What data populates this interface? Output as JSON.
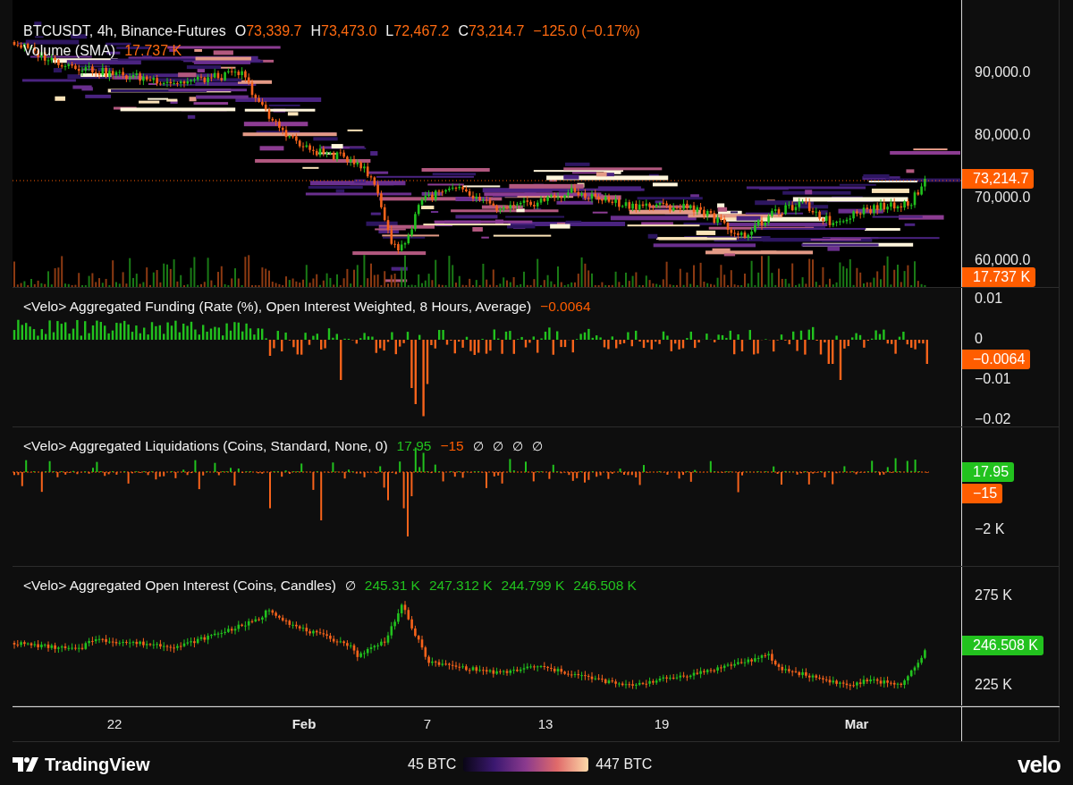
{
  "symbol_legend": {
    "title": "BTCUSDT, 4h, Binance-Futures",
    "fields": [
      {
        "label": "O",
        "value": "73,339.7"
      },
      {
        "label": "H",
        "value": "73,473.0"
      },
      {
        "label": "L",
        "value": "72,467.2"
      },
      {
        "label": "C",
        "value": "73,214.7"
      }
    ],
    "change": "−125.0 (−0.17%)"
  },
  "volume_legend": {
    "title": "Volume (SMA)",
    "value": "17.737 K"
  },
  "price_axis": {
    "ticks": [
      "90,000.0",
      "80,000.0",
      "70,000.0",
      "60,000.0"
    ],
    "tags": [
      {
        "text": "73,214.7",
        "color": "#ff5d00"
      },
      {
        "text": "17.737 K",
        "color": "#ff5d00"
      }
    ]
  },
  "indicator_panes": [
    {
      "kind": "funding",
      "title": "<Velo> Aggregated Funding (Rate (%), Open Interest Weighted, 8 Hours, Average)",
      "legend_items": [
        {
          "kind": "value",
          "text": "−0.0064",
          "color": "#ff5d00"
        }
      ],
      "ticks": [
        "0.01",
        "0",
        "−0.01",
        "−0.02"
      ],
      "tags": [
        {
          "text": "−0.0064",
          "color": "#ff5d00"
        }
      ]
    },
    {
      "kind": "liquidations",
      "title": "<Velo> Aggregated Liquidations (Coins, Standard, None, 0)",
      "legend_items": [
        {
          "kind": "value",
          "text": "17.95",
          "color": "#22c21e"
        },
        {
          "kind": "value",
          "text": "−15",
          "color": "#ff5d00"
        },
        {
          "kind": "na",
          "text": "∅"
        },
        {
          "kind": "na",
          "text": "∅"
        },
        {
          "kind": "na",
          "text": "∅"
        },
        {
          "kind": "na",
          "text": "∅"
        }
      ],
      "ticks": [
        "−2 K"
      ],
      "tags": [
        {
          "text": "17.95",
          "color": "#22c21e"
        },
        {
          "text": "−15",
          "color": "#ff5d00"
        }
      ]
    },
    {
      "kind": "open_interest",
      "title": "<Velo> Aggregated Open Interest (Coins, Candles)",
      "legend_items": [
        {
          "kind": "na",
          "text": "∅"
        },
        {
          "kind": "value",
          "text": "245.31 K",
          "color": "#22c21e"
        },
        {
          "kind": "value",
          "text": "247.312 K",
          "color": "#22c21e"
        },
        {
          "kind": "value",
          "text": "244.799 K",
          "color": "#22c21e"
        },
        {
          "kind": "value",
          "text": "246.508 K",
          "color": "#22c21e"
        }
      ],
      "ticks": [
        "275 K",
        "225 K"
      ],
      "tags": [
        {
          "text": "246.508 K",
          "color": "#22c21e"
        }
      ]
    }
  ],
  "x_axis": {
    "labels": [
      {
        "text": "22",
        "bold": false
      },
      {
        "text": "Feb",
        "bold": true
      },
      {
        "text": "7",
        "bold": false
      },
      {
        "text": "13",
        "bold": false
      },
      {
        "text": "19",
        "bold": false
      },
      {
        "text": "Mar",
        "bold": true
      }
    ]
  },
  "footer": {
    "brand": "TradingView",
    "scale_min": "45 BTC",
    "scale_max": "447 BTC",
    "brand_right": "velo"
  }
}
